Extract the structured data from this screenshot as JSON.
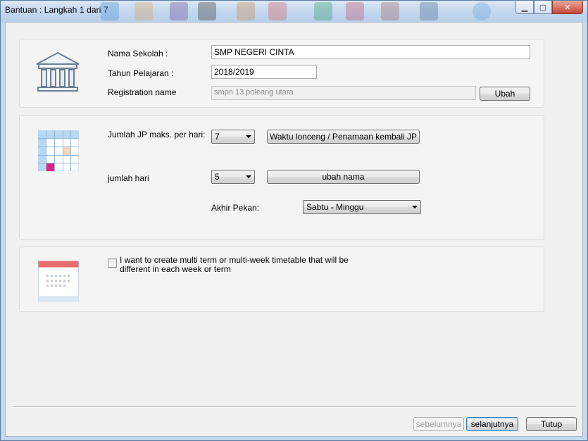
{
  "window": {
    "title": "Bantuan : Langkah 1 dari 7"
  },
  "school": {
    "name_label": "Nama Sekolah :",
    "name_value": "SMP NEGERI CINTA",
    "year_label": "Tahun Pelajaran :",
    "year_value": "2018/2019",
    "registration_label": "Registration name",
    "registration_value": "smpn 13 poleang utara",
    "change_button": "Ubah"
  },
  "schedule": {
    "periods_label": "Jumlah JP maks. per hari:",
    "periods_value": "7",
    "bell_button": "Waktu lonceng / Penamaan kembali JP",
    "days_label": "jumlah hari",
    "days_value": "5",
    "rename_button": "ubah nama",
    "weekend_label": "Akhir Pekan:",
    "weekend_value": "Sabtu - Minggu"
  },
  "multiterm": {
    "checkbox_label_line1": "I want to create multi term or multi-week timetable that will be",
    "checkbox_label_line2": "different in each week or term",
    "checked": false
  },
  "footer": {
    "prev_button": "sebelumnya",
    "next_button": "selanjutnya",
    "close_button": "Tutup"
  },
  "colors": {
    "highlight_cell": "#e2208a",
    "orange_cell": "#fbd7b8",
    "calendar_header": "#e76d6d",
    "grid_blue": "#b7d7f2"
  },
  "icons": {
    "school": "school-building-icon",
    "timetable": "timetable-grid-icon",
    "calendar": "calendar-icon"
  }
}
